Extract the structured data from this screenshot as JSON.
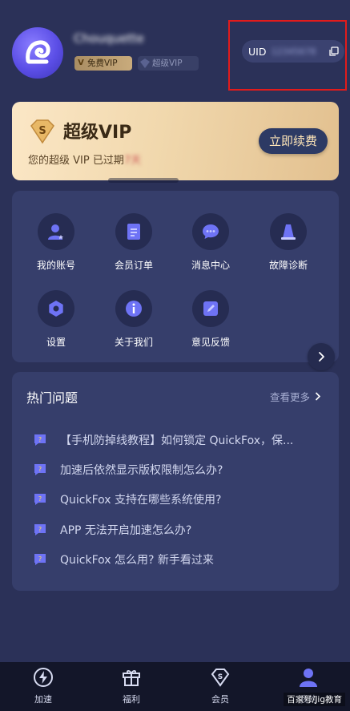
{
  "profile": {
    "username": "Chouquette",
    "badge_free": "免费VIP",
    "badge_free_icon_letter": "V",
    "badge_super": "超级VIP",
    "badge_super_icon_letter": "S",
    "uid_label": "UID",
    "uid_value": "12345678",
    "avatar_icon": "fox-logo-icon",
    "copy_icon": "copy-icon"
  },
  "vip_card": {
    "icon_letter": "S",
    "title": "超级VIP",
    "subtitle_prefix": "您的超级 VIP 已过期",
    "subtitle_blurred": "7天",
    "renew_button": "立即续费"
  },
  "menu": {
    "items": [
      {
        "label": "我的账号",
        "icon": "user-icon"
      },
      {
        "label": "会员订单",
        "icon": "order-icon"
      },
      {
        "label": "消息中心",
        "icon": "message-icon"
      },
      {
        "label": "故障诊断",
        "icon": "diagnose-icon"
      },
      {
        "label": "设置",
        "icon": "settings-icon"
      },
      {
        "label": "关于我们",
        "icon": "info-icon"
      },
      {
        "label": "意见反馈",
        "icon": "feedback-icon"
      }
    ],
    "next_icon": "chevron-right-icon"
  },
  "faq": {
    "title": "热门问题",
    "more": "查看更多",
    "items": [
      "【手机防掉线教程】如何锁定 QuickFox，保...",
      "加速后依然显示版权限制怎么办?",
      "QuickFox 支持在哪些系统使用?",
      "APP 无法开启加速怎么办?",
      "QuickFox 怎么用? 新手看过来"
    ]
  },
  "bottom_nav": {
    "items": [
      {
        "label": "加速",
        "icon": "lightning-icon"
      },
      {
        "label": "福利",
        "icon": "gift-icon"
      },
      {
        "label": "会员",
        "icon": "vip-diamond-icon"
      },
      {
        "label": "我的",
        "icon": "profile-icon",
        "active": true
      }
    ]
  },
  "watermark": "百家号/Jig教育",
  "colors": {
    "background": "#2b3158",
    "card": "#363e6b",
    "accent": "#6b6cf0",
    "gold": "#f1d8ad",
    "highlight_border": "#e21b1b"
  }
}
